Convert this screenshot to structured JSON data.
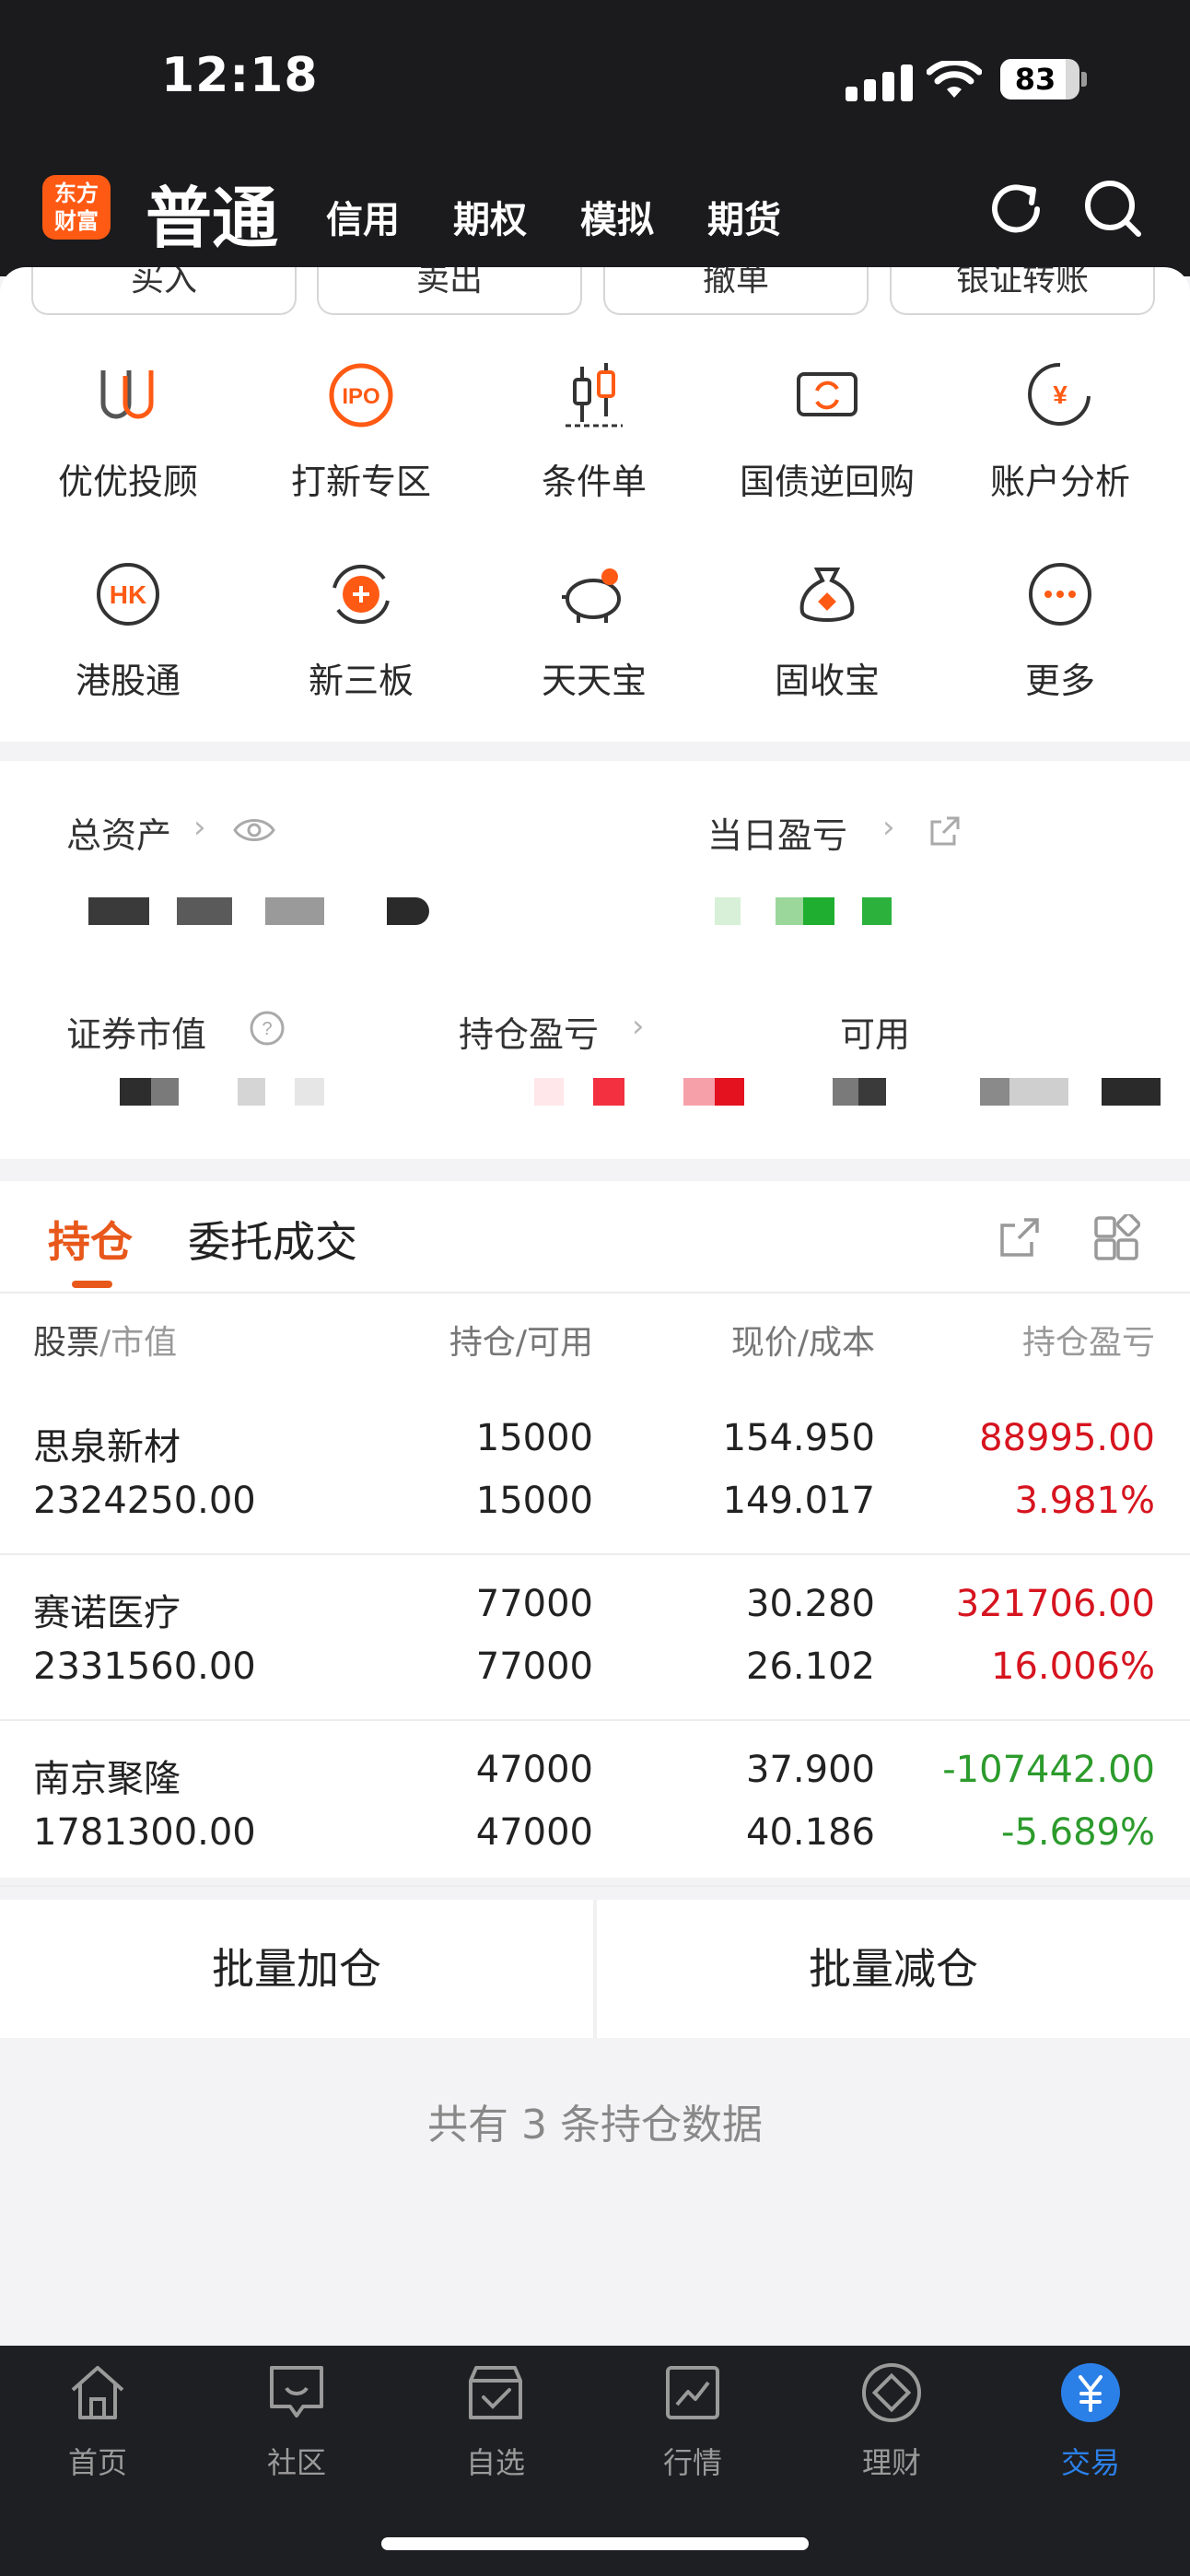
{
  "status_bar": {
    "time": "12:18",
    "battery": "83",
    "battery_level": 83
  },
  "header": {
    "logo_line1": "东方",
    "logo_line2": "财富",
    "active_tab": "普通",
    "tabs": [
      "信用",
      "期权",
      "模拟",
      "期货"
    ]
  },
  "actions": [
    "买入",
    "卖出",
    "撤单",
    "银证转账"
  ],
  "grid": [
    {
      "label": "优优投顾",
      "icon": "uu-advisor-icon"
    },
    {
      "label": "打新专区",
      "icon": "ipo-icon"
    },
    {
      "label": "条件单",
      "icon": "candlestick-icon"
    },
    {
      "label": "国债逆回购",
      "icon": "repo-icon"
    },
    {
      "label": "账户分析",
      "icon": "account-analysis-icon"
    },
    {
      "label": "港股通",
      "icon": "hk-icon"
    },
    {
      "label": "新三板",
      "icon": "new-board-icon"
    },
    {
      "label": "天天宝",
      "icon": "piggy-bank-icon"
    },
    {
      "label": "固收宝",
      "icon": "money-bag-icon"
    },
    {
      "label": "更多",
      "icon": "more-icon"
    }
  ],
  "assets": {
    "total_assets_label": "总资产",
    "daily_pnl_label": "当日盈亏",
    "securities_value_label": "证券市值",
    "position_pnl_label": "持仓盈亏",
    "available_label": "可用"
  },
  "holdings": {
    "tabs": [
      "持仓",
      "委托成交"
    ],
    "columns": {
      "stock": "股票",
      "stock_sub": "/市值",
      "qty": "持仓",
      "qty_sub": "/可用",
      "price": "现价",
      "price_sub": "/成本",
      "pnl": "持仓盈亏"
    },
    "rows": [
      {
        "name": "思泉新材",
        "market_value": "2324250.00",
        "qty": "15000",
        "available": "15000",
        "price": "154.950",
        "cost": "149.017",
        "pnl": "88995.00",
        "pnl_pct": "3.981%",
        "trend": "up"
      },
      {
        "name": "赛诺医疗",
        "market_value": "2331560.00",
        "qty": "77000",
        "available": "77000",
        "price": "30.280",
        "cost": "26.102",
        "pnl": "321706.00",
        "pnl_pct": "16.006%",
        "trend": "up"
      },
      {
        "name": "南京聚隆",
        "market_value": "1781300.00",
        "qty": "47000",
        "available": "47000",
        "price": "37.900",
        "cost": "40.186",
        "pnl": "-107442.00",
        "pnl_pct": "-5.689%",
        "trend": "down"
      }
    ]
  },
  "batch": {
    "add": "批量加仓",
    "reduce": "批量减仓"
  },
  "summary": "共有 3 条持仓数据",
  "nav": [
    {
      "label": "首页",
      "icon": "home-icon"
    },
    {
      "label": "社区",
      "icon": "community-icon"
    },
    {
      "label": "自选",
      "icon": "watchlist-icon"
    },
    {
      "label": "行情",
      "icon": "market-icon"
    },
    {
      "label": "理财",
      "icon": "wealth-icon"
    },
    {
      "label": "交易",
      "icon": "trade-icon",
      "active": true
    }
  ],
  "colors": {
    "accent": "#e8581b",
    "up": "#d6141f",
    "down": "#2c9b2c",
    "nav_active": "#2b80e8"
  }
}
